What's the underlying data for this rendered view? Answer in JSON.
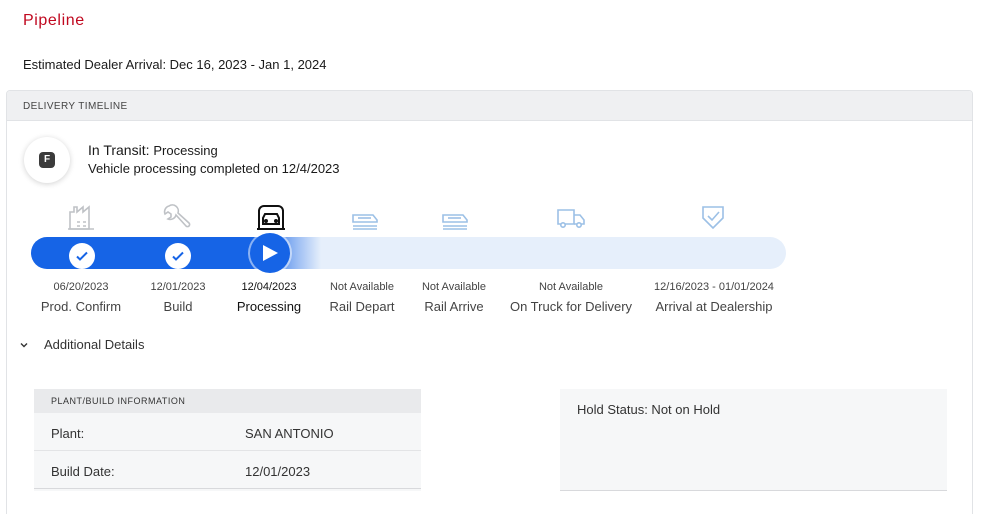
{
  "page": {
    "title": "Pipeline",
    "eta_label": "Estimated Dealer Arrival: Dec 16, 2023 - Jan 1, 2024"
  },
  "card": {
    "header": "DELIVERY TIMELINE"
  },
  "status": {
    "badge_letter": "F",
    "label": "In Transit: ",
    "value": "Processing",
    "detail": "Vehicle processing completed on 12/4/2023"
  },
  "colors": {
    "brand_red": "#c0081f",
    "progress_blue": "#1664e6",
    "track_bg": "#e6effb",
    "pending_icon": "#9cc0e6"
  },
  "stages": [
    {
      "name": "Prod. Confirm",
      "date": "06/20/2023",
      "icon": "factory-icon",
      "state": "done"
    },
    {
      "name": "Build",
      "date": "12/01/2023",
      "icon": "wrench-icon",
      "state": "done"
    },
    {
      "name": "Processing",
      "date": "12/04/2023",
      "icon": "car-wash-icon",
      "state": "current"
    },
    {
      "name": "Rail Depart",
      "date": "Not Available",
      "icon": "rail-car-icon",
      "state": "pending"
    },
    {
      "name": "Rail Arrive",
      "date": "Not Available",
      "icon": "rail-car-icon",
      "state": "pending"
    },
    {
      "name": "On Truck for Delivery",
      "date": "Not Available",
      "icon": "truck-icon",
      "state": "pending"
    },
    {
      "name": "Arrival at Dealership",
      "date": "12/16/2023 - 01/01/2024",
      "icon": "shield-check-icon",
      "state": "pending"
    }
  ],
  "details": {
    "toggle_label": "Additional Details",
    "plant_panel": {
      "header": "PLANT/BUILD INFORMATION",
      "rows": [
        {
          "label": "Plant:",
          "value": "SAN ANTONIO"
        },
        {
          "label": "Build Date:",
          "value": "12/01/2023"
        }
      ]
    },
    "hold_status": "Hold Status: Not on Hold"
  }
}
